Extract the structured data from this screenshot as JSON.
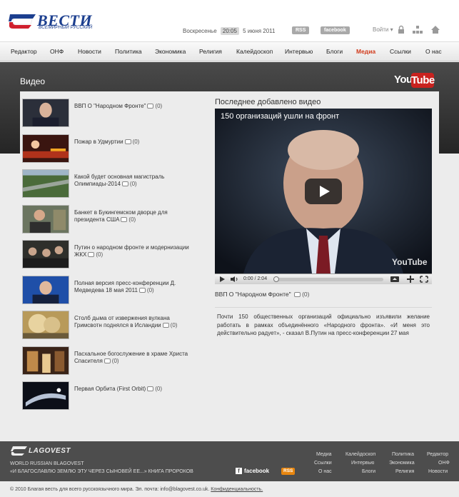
{
  "header": {
    "logo_word": "ВЕСТИ",
    "logo_sub": "ВСЕМИРНЫЙ РУССКИЙ",
    "day": "Воскресенье",
    "time": "20:05",
    "date": "5 июня 2011",
    "rss_label": "RSS",
    "facebook_label": "facebook",
    "login_label": "Войти ▾"
  },
  "nav": [
    "Редактор",
    "ОНФ",
    "Новости",
    "Политика",
    "Экономика",
    "Религия",
    "Калейдоскоп",
    "Интервью",
    "Блоги",
    "Медиа",
    "Ссылки",
    "О нас"
  ],
  "nav_active": "Медиа",
  "section": {
    "title": "Видео",
    "youtube_you": "You",
    "youtube_tube": "Tube"
  },
  "videos": [
    {
      "title": "ВВП О \"Народном Фронте\"",
      "comments": "(0)"
    },
    {
      "title": "Пожар в Удмуртии",
      "comments": "(0)"
    },
    {
      "title": "Какой будет основная магистраль Олимпиады-2014",
      "comments": "(0)"
    },
    {
      "title": "Банкет в Букингемском дворце для президента США",
      "comments": "(0)"
    },
    {
      "title": "Путин о народном фронте и модернизации ЖКХ",
      "comments": "(0)"
    },
    {
      "title": "Полная версия пресс-конференции Д. Медведева 18 мая 2011",
      "comments": "(0)"
    },
    {
      "title": "Столб дыма от извержения вулкана Гримсвотн поднялся в Исландии",
      "comments": "(0)"
    },
    {
      "title": "Пасхальное богослужение в храме Христа Спасителя",
      "comments": "(0)"
    },
    {
      "title": "Первая Орбита (First Orbit)",
      "comments": "(0)"
    }
  ],
  "latest": {
    "heading": "Последнее добавлено видео",
    "player_title": "150 организаций ушли на фронт",
    "time": "0:00 / 2:04",
    "watermark": "YouTube",
    "video_title": "ВВП О \"Народном Фронте\"",
    "comments": "(0)",
    "description": "Почти 150 общественных организаций официально изъявили желание работать в рамках объединённого «Народного фронта». «И меня это действительно радует», - сказал В.Путин на пресс-конференции 27 мая"
  },
  "footer": {
    "logo_word": "LAGOVEST",
    "line1": "WORLD RUSSIAN BLAGOVEST",
    "line2": "«И БЛАГОСЛАВЛЮ ЗЕМЛЮ ЭТУ ЧЕРЕЗ СЫНОВЕЙ ЕЕ...» КНИГА ПРОРОКОВ",
    "facebook_label": "facebook",
    "rss_label": "RSS",
    "links": [
      [
        "Медиа",
        "Калейдоскоп",
        "Политика",
        "Редактор"
      ],
      [
        "Ссылки",
        "Интервью",
        "Экономика",
        "ОНФ"
      ],
      [
        "О нас",
        "Блоги",
        "Религия",
        "Новости"
      ]
    ],
    "copyright": "© 2010 Благая весть для всего русскоязычного мира. Эл. почта: info@blagovest.co.uk.",
    "privacy": "Конфиденциальность."
  },
  "colors": {
    "brand_blue": "#1c3f8f",
    "brand_red": "#d0202e",
    "nav_active": "#d03a1b",
    "youtube_red": "#c9221f",
    "rss_orange": "#e8860f"
  }
}
